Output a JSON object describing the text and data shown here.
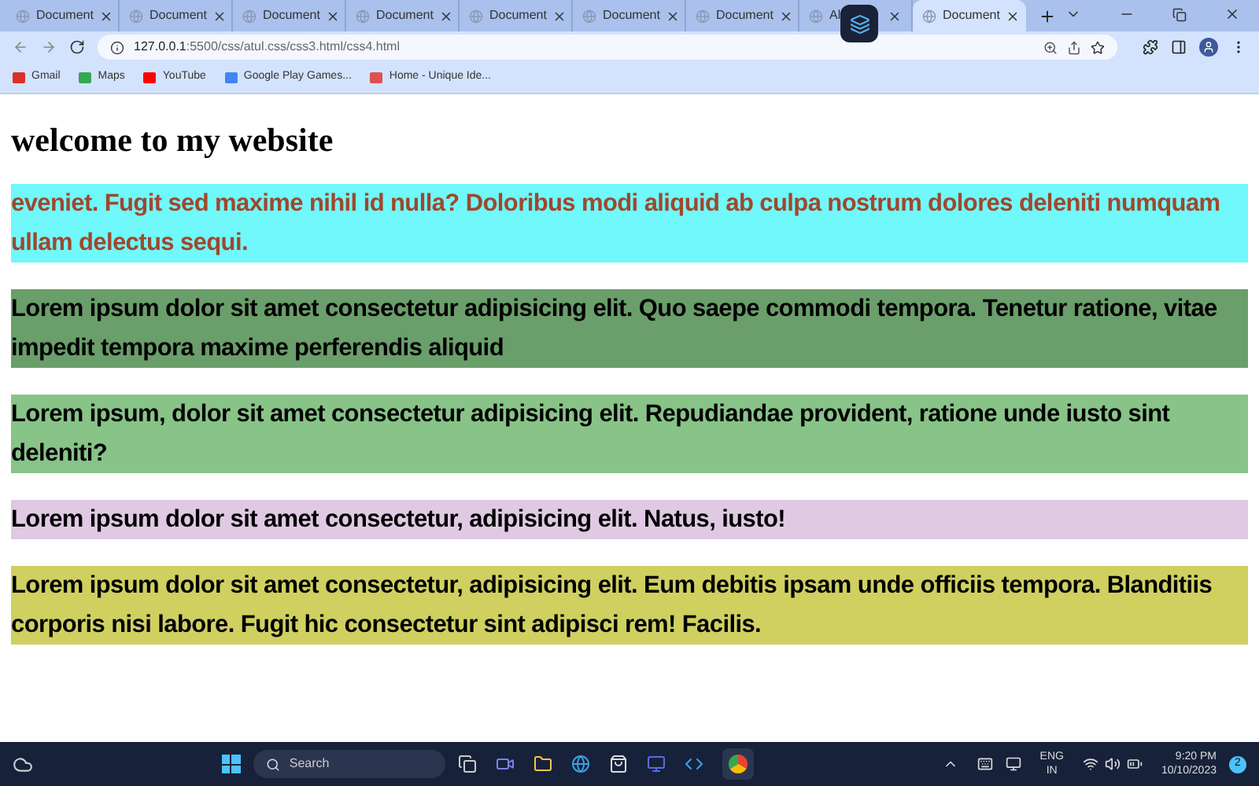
{
  "tabs": [
    {
      "title": "Document",
      "selected": false
    },
    {
      "title": "Document",
      "selected": false
    },
    {
      "title": "Document",
      "selected": false
    },
    {
      "title": "Document",
      "selected": false
    },
    {
      "title": "Document",
      "selected": false
    },
    {
      "title": "Document",
      "selected": false
    },
    {
      "title": "Document",
      "selected": false
    },
    {
      "title": "Al",
      "selected": false
    },
    {
      "title": "Document",
      "selected": true
    }
  ],
  "address": {
    "host": "127.0.0.1",
    "path": ":5500/css/atul.css/css3.html/css4.html"
  },
  "bookmarks": [
    "Gmail",
    "Maps",
    "YouTube",
    "Google Play Games...",
    "Home - Unique Ide..."
  ],
  "page": {
    "heading": "welcome to my website",
    "blocks": [
      {
        "text": "eveniet. Fugit sed maxime nihil id nulla? Doloribus modi aliquid ab culpa nostrum dolores deleniti numquam ullam delectus sequi.",
        "color": "#70f8fa",
        "kind": "accent"
      },
      {
        "text": "Lorem ipsum dolor sit amet consectetur adipisicing elit. Quo saepe commodi tempora. Tenetur ratione, vitae impedit tempora maxime perferendis aliquid",
        "color": "#6a9e6a",
        "kind": "plain"
      },
      {
        "text": "Lorem ipsum, dolor sit amet consectetur adipisicing elit. Repudiandae provident, ratione unde iusto sint deleniti?",
        "color": "#88c388",
        "kind": "plain"
      },
      {
        "text": "Lorem ipsum dolor sit amet consectetur, adipisicing elit. Natus, iusto!",
        "color": "#dfc9e3",
        "kind": "plain"
      },
      {
        "text": "Lorem ipsum dolor sit amet consectetur, adipisicing elit. Eum debitis ipsam unde officiis tempora. Blanditiis corporis nisi labore. Fugit hic consectetur sint adipisci rem! Facilis.",
        "color": "#d0d060",
        "kind": "plain"
      }
    ]
  },
  "taskbar": {
    "search_placeholder": "Search",
    "language": "ENG",
    "region": "IN",
    "time": "9:20 PM",
    "date": "10/10/2023",
    "notifications": "2"
  }
}
